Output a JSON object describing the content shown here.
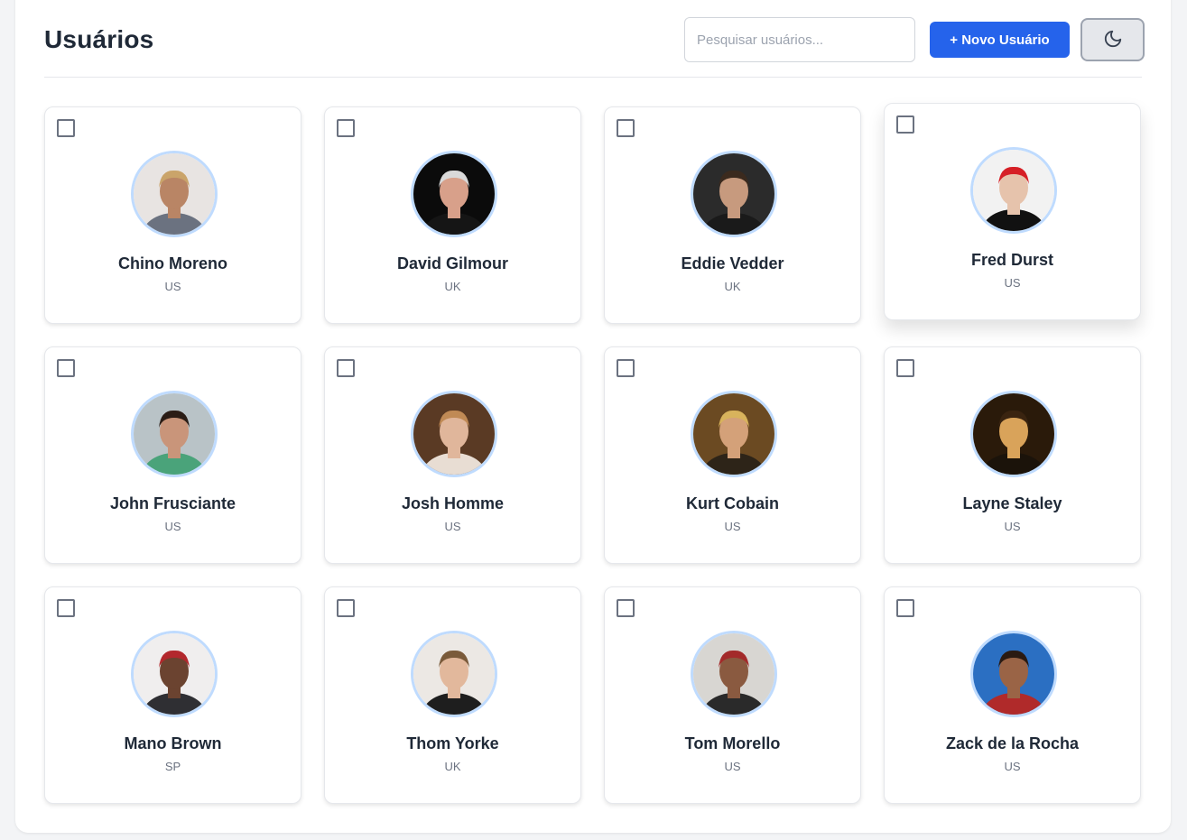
{
  "header": {
    "title": "Usuários",
    "search_placeholder": "Pesquisar usuários...",
    "new_user_label": "+ Novo Usuário",
    "theme_icon": "moon-icon"
  },
  "colors": {
    "primary": "#2563eb",
    "avatar_ring": "#bfdbfe",
    "text": "#1f2937",
    "muted": "#6b7280"
  },
  "users": [
    {
      "name": "Chino Moreno",
      "country": "US",
      "checked": false,
      "avatar": "photo-portrait",
      "bg": "#e8e4e2",
      "skin": "#b98565",
      "hair": "#caa46a",
      "shirt": "#6b7280"
    },
    {
      "name": "David Gilmour",
      "country": "UK",
      "checked": false,
      "avatar": "photo-portrait",
      "bg": "#0b0b0b",
      "skin": "#d8a08a",
      "hair": "#d9d9d9",
      "shirt": "#151515"
    },
    {
      "name": "Eddie Vedder",
      "country": "UK",
      "checked": false,
      "avatar": "photo-portrait",
      "bg": "#2b2b2b",
      "skin": "#c79a7e",
      "hair": "#3b2a1e",
      "shirt": "#1a1a1a"
    },
    {
      "name": "Fred Durst",
      "country": "US",
      "checked": false,
      "avatar": "photo-portrait",
      "bg": "#f2f2f2",
      "skin": "#e6c3ac",
      "hair": "#d61f26",
      "shirt": "#111111"
    },
    {
      "name": "John Frusciante",
      "country": "US",
      "checked": false,
      "avatar": "photo-portrait",
      "bg": "#b9c3c7",
      "skin": "#c9957a",
      "hair": "#2b1d16",
      "shirt": "#4aa37a"
    },
    {
      "name": "Josh Homme",
      "country": "US",
      "checked": false,
      "avatar": "photo-portrait",
      "bg": "#5a3a24",
      "skin": "#e0b69b",
      "hair": "#c08a55",
      "shirt": "#e8ddd3"
    },
    {
      "name": "Kurt Cobain",
      "country": "US",
      "checked": false,
      "avatar": "photo-portrait",
      "bg": "#6b4a22",
      "skin": "#d4a179",
      "hair": "#d8b35c",
      "shirt": "#2d2418"
    },
    {
      "name": "Layne Staley",
      "country": "US",
      "checked": false,
      "avatar": "photo-portrait",
      "bg": "#2a1a0a",
      "skin": "#d9a35a",
      "hair": "#3a2410",
      "shirt": "#1b130a"
    },
    {
      "name": "Mano Brown",
      "country": "SP",
      "checked": false,
      "avatar": "photo-portrait",
      "bg": "#f0eeee",
      "skin": "#6b4330",
      "hair": "#b3282d",
      "shirt": "#2f2f33"
    },
    {
      "name": "Thom Yorke",
      "country": "UK",
      "checked": false,
      "avatar": "photo-portrait",
      "bg": "#ece8e4",
      "skin": "#e2b89c",
      "hair": "#7a5a3a",
      "shirt": "#1e1e1e"
    },
    {
      "name": "Tom Morello",
      "country": "US",
      "checked": false,
      "avatar": "photo-portrait",
      "bg": "#d8d6d2",
      "skin": "#8a5a40",
      "hair": "#a32a2a",
      "shirt": "#2a2a2a"
    },
    {
      "name": "Zack de la Rocha",
      "country": "US",
      "checked": false,
      "avatar": "photo-portrait",
      "bg": "#2b6fc2",
      "skin": "#9a6446",
      "hair": "#2a1a12",
      "shirt": "#b02a2a"
    }
  ]
}
